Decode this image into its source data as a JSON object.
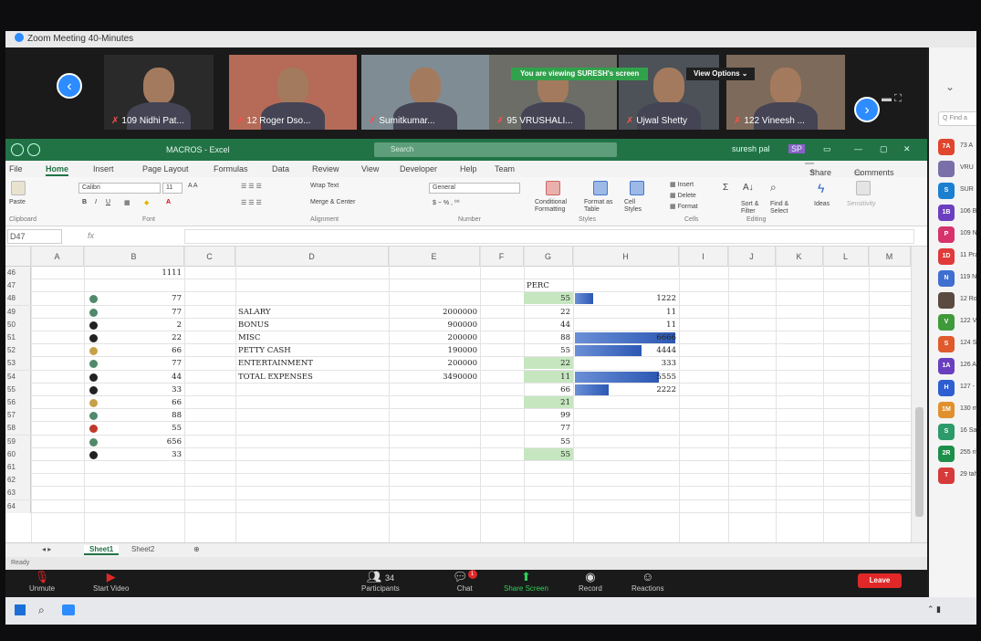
{
  "zoom": {
    "window_title": "Zoom Meeting 40-Minutes",
    "viewing_banner": "You are viewing SURESH's screen",
    "view_options": "View Options ⌄",
    "participants": [
      {
        "name": "109 Nidhi Pat..."
      },
      {
        "name": "12 Roger Dso..."
      },
      {
        "name": "Sumitkumar..."
      },
      {
        "name": "95 VRUSHALI..."
      },
      {
        "name": "Ujwal Shetty"
      },
      {
        "name": "122 Vineesh ..."
      }
    ],
    "controls": {
      "unmute": "Unmute",
      "start_video": "Start Video",
      "participants_label": "Participants",
      "participants_count": "34",
      "chat": "Chat",
      "chat_badge": "1",
      "share_screen": "Share Screen",
      "record": "Record",
      "reactions": "Reactions",
      "leave": "Leave"
    }
  },
  "side_panel": {
    "search_placeholder": "Q Find a",
    "items": [
      {
        "avatar": "7A",
        "label": "73 A",
        "color": "#e0452d"
      },
      {
        "avatar": "",
        "label": "VRU",
        "color": "#7a6fa8"
      },
      {
        "avatar": "S",
        "label": "SUR",
        "color": "#1d7fd0"
      },
      {
        "avatar": "1B",
        "label": "106 B",
        "color": "#6b3fbf"
      },
      {
        "avatar": "P",
        "label": "109 N",
        "color": "#d6336c"
      },
      {
        "avatar": "1D",
        "label": "11 Pra",
        "color": "#e03a3a"
      },
      {
        "avatar": "N",
        "label": "119 N",
        "color": "#3f6fd0"
      },
      {
        "avatar": "",
        "label": "12 Rog",
        "color": "#5a4a40"
      },
      {
        "avatar": "V",
        "label": "122 Vi",
        "color": "#3f9a3a"
      },
      {
        "avatar": "S",
        "label": "124 Sh",
        "color": "#e05a2d"
      },
      {
        "avatar": "1A",
        "label": "126 An",
        "color": "#6a3fbf"
      },
      {
        "avatar": "H",
        "label": "127 - H",
        "color": "#2d5fd0"
      },
      {
        "avatar": "1M",
        "label": "130 meg",
        "color": "#e0902d"
      },
      {
        "avatar": "S",
        "label": "16 Sachi",
        "color": "#2d9a6a"
      },
      {
        "avatar": "2R",
        "label": "255 riya",
        "color": "#1d8f4a"
      },
      {
        "avatar": "T",
        "label": "29 tahir",
        "color": "#d63a3a"
      }
    ]
  },
  "excel": {
    "doc_title": "MACROS - Excel",
    "search_placeholder": "Search",
    "user": "suresh pal",
    "user_initials": "SP",
    "tabs": [
      "File",
      "Home",
      "Insert",
      "Page Layout",
      "Formulas",
      "Data",
      "Review",
      "View",
      "Developer",
      "Help",
      "Team"
    ],
    "share": "Share",
    "comments": "Comments",
    "ribbon": {
      "paste": "Paste",
      "clipboard": "Clipboard",
      "font_name": "Calibri",
      "font_size": "11",
      "font": "Font",
      "wrap_text": "Wrap Text",
      "merge_center": "Merge & Center",
      "alignment": "Alignment",
      "number_format": "General",
      "number": "Number",
      "conditional": "Conditional Formatting",
      "format_table": "Format as Table",
      "cell_styles": "Cell Styles",
      "styles": "Styles",
      "insert": "Insert",
      "delete": "Delete",
      "format": "Format",
      "cells": "Cells",
      "sort_filter": "Sort & Filter",
      "find_select": "Find & Select",
      "editing": "Editing",
      "ideas": "Ideas",
      "sensitivity": "Sensitivity"
    },
    "name_box": "D47",
    "fx": "fx",
    "columns": [
      "A",
      "B",
      "C",
      "D",
      "E",
      "F",
      "G",
      "H",
      "I",
      "J",
      "K",
      "L",
      "M"
    ],
    "rows": [
      {
        "n": "46",
        "b": "1111",
        "dot": "",
        "d": "",
        "e": "",
        "g": "",
        "h": ""
      },
      {
        "n": "47",
        "b": "",
        "dot": "",
        "d": "",
        "e": "",
        "g": "PERC",
        "h": ""
      },
      {
        "n": "48",
        "b": "77",
        "dot": "#4f8a6a",
        "d": "",
        "e": "",
        "g": "55",
        "h": "1222"
      },
      {
        "n": "49",
        "b": "77",
        "dot": "#4f8a6a",
        "d": "SALARY",
        "e": "2000000",
        "g": "22",
        "h": "11"
      },
      {
        "n": "50",
        "b": "2",
        "dot": "#222222",
        "d": "BONUS",
        "e": "900000",
        "g": "44",
        "h": "11"
      },
      {
        "n": "51",
        "b": "22",
        "dot": "#222222",
        "d": "MISC",
        "e": "200000",
        "g": "88",
        "h": "6666"
      },
      {
        "n": "52",
        "b": "66",
        "dot": "#c9a04a",
        "d": "PETTY CASH",
        "e": "190000",
        "g": "55",
        "h": "4444"
      },
      {
        "n": "53",
        "b": "77",
        "dot": "#4f8a6a",
        "d": "ENTERTAINMENT",
        "e": "200000",
        "g": "22",
        "h": "333"
      },
      {
        "n": "54",
        "b": "44",
        "dot": "#222222",
        "d": "TOTAL EXPENSES",
        "e": "3490000",
        "g": "11",
        "h": "5555"
      },
      {
        "n": "55",
        "b": "33",
        "dot": "#222222",
        "d": "",
        "e": "",
        "g": "66",
        "h": "2222"
      },
      {
        "n": "56",
        "b": "66",
        "dot": "#c9a04a",
        "d": "",
        "e": "",
        "g": "21",
        "h": ""
      },
      {
        "n": "57",
        "b": "88",
        "dot": "#4f8a6a",
        "d": "",
        "e": "",
        "g": "99",
        "h": ""
      },
      {
        "n": "58",
        "b": "55",
        "dot": "#c0392b",
        "d": "",
        "e": "",
        "g": "77",
        "h": ""
      },
      {
        "n": "59",
        "b": "656",
        "dot": "#4f8a6a",
        "d": "",
        "e": "",
        "g": "55",
        "h": ""
      },
      {
        "n": "60",
        "b": "33",
        "dot": "#222222",
        "d": "",
        "e": "",
        "g": "55",
        "h": ""
      },
      {
        "n": "61",
        "b": "",
        "dot": "",
        "d": "",
        "e": "",
        "g": "",
        "h": ""
      },
      {
        "n": "62",
        "b": "",
        "dot": "",
        "d": "",
        "e": "",
        "g": "",
        "h": ""
      },
      {
        "n": "63",
        "b": "",
        "dot": "",
        "d": "",
        "e": "",
        "g": "",
        "h": ""
      },
      {
        "n": "64",
        "b": "",
        "dot": "",
        "d": "",
        "e": "",
        "g": "",
        "h": ""
      }
    ],
    "green_rows": [
      "48",
      "53",
      "54",
      "56",
      "60"
    ],
    "bars": {
      "max": 6666,
      "rows": [
        "48",
        "51",
        "52",
        "54",
        "55"
      ]
    },
    "sheets": [
      "Sheet1",
      "Sheet2"
    ],
    "active_sheet": "Sheet1",
    "status": "Ready"
  },
  "taskbar": {
    "tray": "⌃ ▮"
  }
}
